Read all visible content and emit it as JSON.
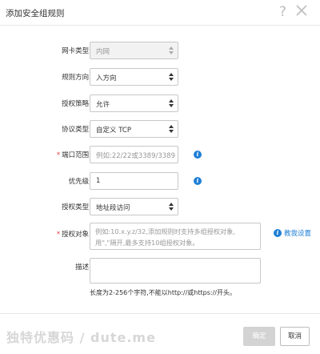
{
  "dialog": {
    "title": "添加安全组规则",
    "help_icon": "question-mark-icon",
    "close_icon": "close-icon"
  },
  "form": {
    "nic_type": {
      "label": "网卡类型:",
      "value": "内网",
      "disabled": true
    },
    "direction": {
      "label": "规则方向:",
      "value": "入方向"
    },
    "policy": {
      "label": "授权策略:",
      "value": "允许"
    },
    "protocol": {
      "label": "协议类型:",
      "value": "自定义 TCP"
    },
    "port_range": {
      "required_mark": "*",
      "label": "端口范围:",
      "placeholder": "例如:22/22或3389/3389",
      "value": ""
    },
    "priority": {
      "label": "优先级:",
      "value": "1"
    },
    "auth_type": {
      "label": "授权类型:",
      "value": "地址段访问"
    },
    "auth_object": {
      "required_mark": "*",
      "label": "授权对象:",
      "placeholder": "例如:10.x.y.z/32,添加规则时支持多组授权对象,用\",\"隔开,最多支持10组授权对象。",
      "teach_link": "教我设置"
    },
    "description": {
      "label": "描述:",
      "value": "",
      "help": "长度为2-256个字符,不能以http://或https://开头。"
    }
  },
  "footer": {
    "watermark": "独特优惠码 / dute.me",
    "ok_label": "确定",
    "cancel_label": "取消"
  },
  "colors": {
    "accent": "#1e7fd6",
    "required": "#e4393c",
    "disabled_button": "#d3d3d3"
  }
}
